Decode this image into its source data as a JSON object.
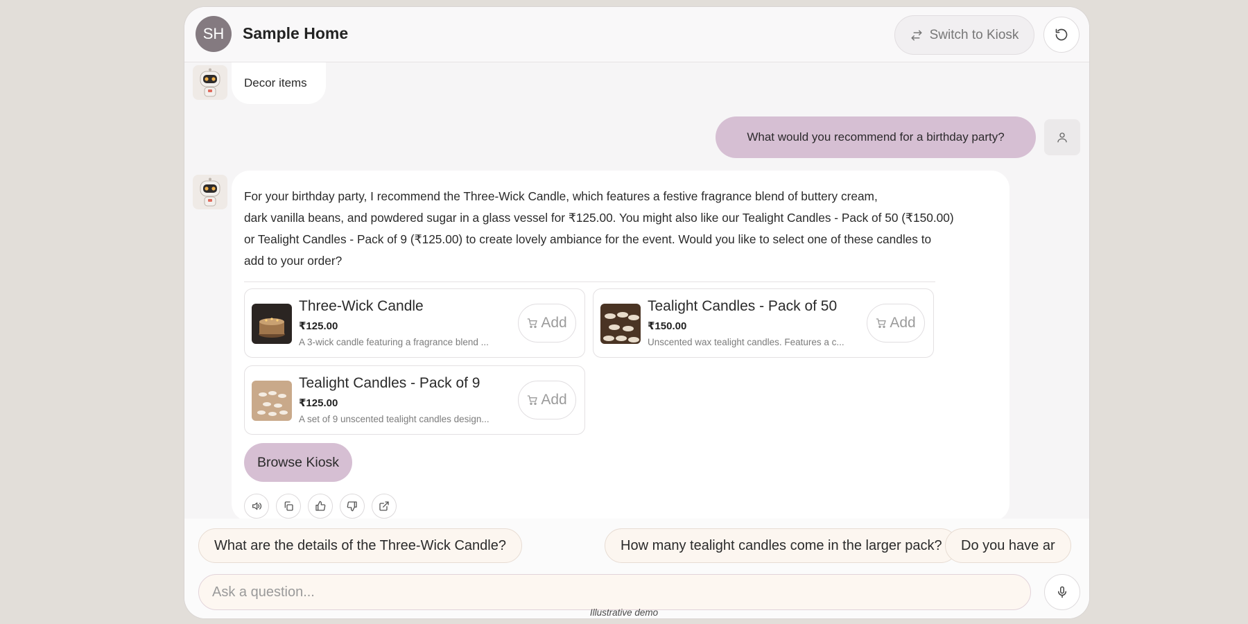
{
  "header": {
    "avatar_initials": "SH",
    "title": "Sample Home",
    "switch_label": "Switch to Kiosk"
  },
  "chat": {
    "bot_message_1": "Decor items",
    "user_message": "What would you recommend for a birthday party?",
    "bot_answer_lines": [
      "For your birthday party, I recommend the Three-Wick Candle, which features a festive fragrance blend of buttery cream,",
      "dark vanilla beans, and powdered sugar in a glass vessel for ₹125.00. You might also like our Tealight Candles - Pack of 50 (₹150.00)",
      "or Tealight Candles - Pack of 9 (₹125.00) to create lovely ambiance for the event. Would you like to select one of these candles to",
      "add to your order?"
    ],
    "products": [
      {
        "name": "Three-Wick Candle",
        "price": "₹125.00",
        "description": "A 3-wick candle featuring a fragrance blend ...",
        "add_label": "Add"
      },
      {
        "name": "Tealight Candles - Pack of 50",
        "price": "₹150.00",
        "description": "Unscented wax tealight candles. Features a c...",
        "add_label": "Add"
      },
      {
        "name": "Tealight Candles - Pack of 9",
        "price": "₹125.00",
        "description": "A set of 9 unscented tealight candles design...",
        "add_label": "Add"
      }
    ],
    "browse_label": "Browse Kiosk",
    "actions": [
      "speaker-icon",
      "copy-icon",
      "thumbs-up-icon",
      "thumbs-down-icon",
      "external-link-icon"
    ]
  },
  "suggestions": [
    "What are the details of the Three-Wick Candle?",
    "How many tealight candles come in the larger pack?",
    "Do you have ar"
  ],
  "input": {
    "placeholder": "Ask a question..."
  },
  "footnote": "Illustrative demo",
  "colors": {
    "accent": "#d6bfd3",
    "chip_bg": "#fcf6f0",
    "avatar_bg": "#847a80"
  }
}
